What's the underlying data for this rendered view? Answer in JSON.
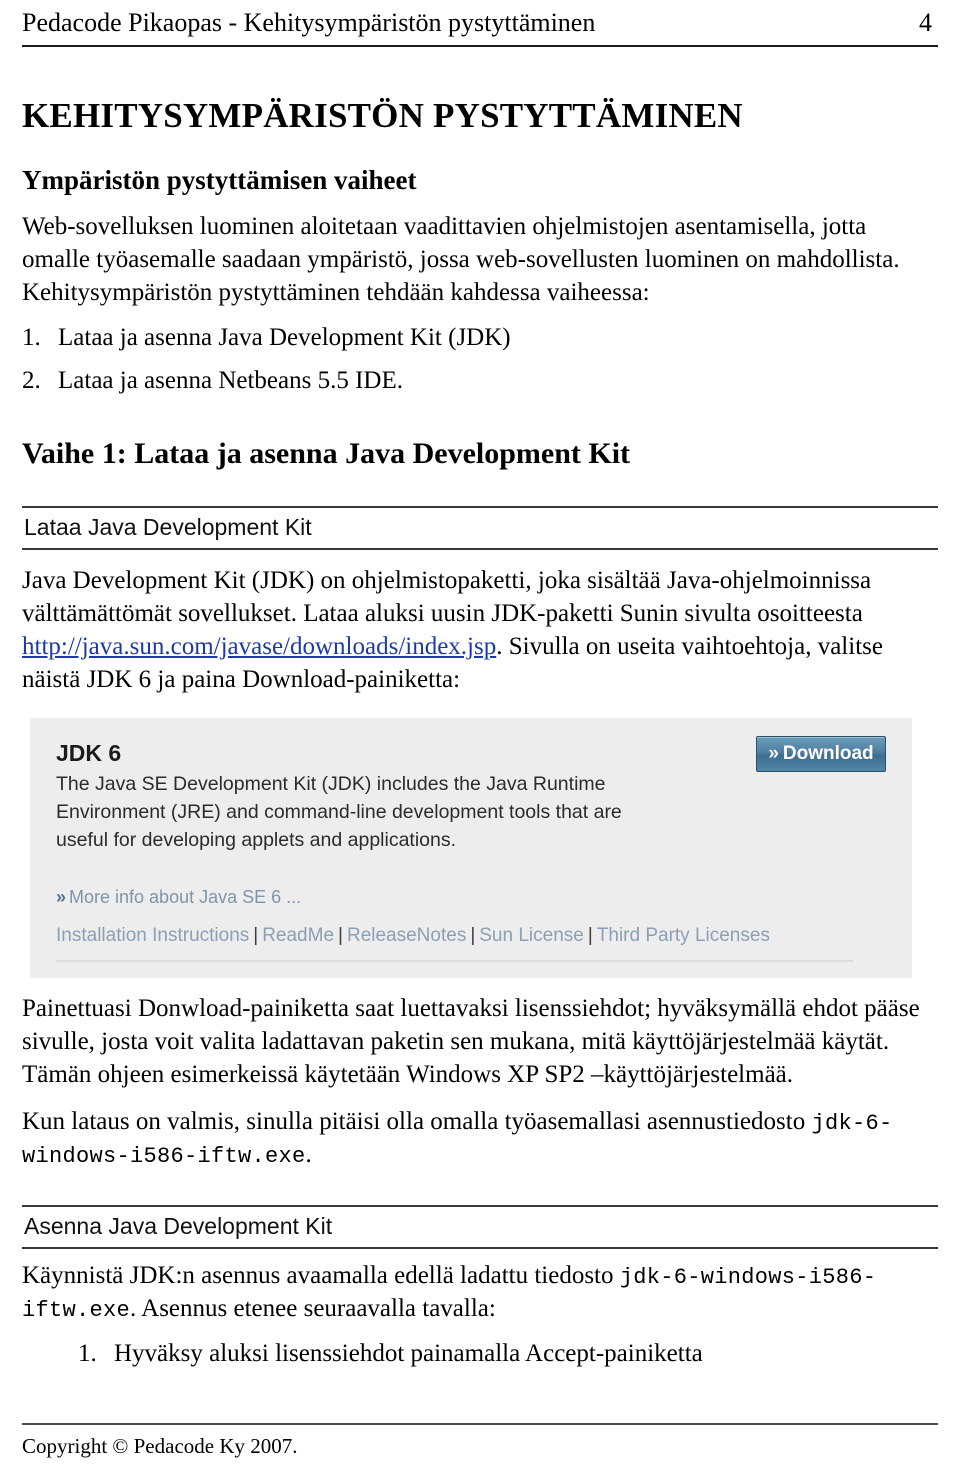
{
  "header": {
    "title": "Pedacode Pikaopas - Kehitysympäristön pystyttäminen",
    "page_number": "4"
  },
  "chapter": {
    "title": "KEHITYSYMPÄRISTÖN PYSTYTTÄMINEN"
  },
  "section_phases": {
    "title": "Ympäristön pystyttämisen vaiheet",
    "intro": "Web-sovelluksen luominen aloitetaan vaadittavien ohjelmistojen asentamisella, jotta omalle työasemalle saadaan ympäristö, jossa web-sovellusten luominen on mahdollista. Kehitysympäristön pystyttäminen tehdään kahdessa vaiheessa:",
    "steps": [
      {
        "num": "1.",
        "text": "Lataa ja asenna Java Development Kit (JDK)"
      },
      {
        "num": "2.",
        "text": "Lataa ja asenna Netbeans 5.5 IDE."
      }
    ]
  },
  "phase1": {
    "title": "Vaihe 1: Lataa ja asenna Java Development Kit"
  },
  "download_jdk": {
    "heading": "Lataa Java Development Kit",
    "paragraph_before_url": "Java Development Kit (JDK) on ohjelmistopaketti, joka sisältää Java-ohjelmoinnissa välttämättömät sovellukset. Lataa aluksi uusin JDK-paketti Sunin sivulta osoitteesta ",
    "url": "http://java.sun.com/javase/downloads/index.jsp",
    "paragraph_after_url": ". Sivulla on useita vaihtoehtoja, valitse näistä JDK 6 ja paina Download-painiketta:"
  },
  "jdk_screenshot": {
    "title": "JDK 6",
    "description": "The Java SE Development Kit (JDK) includes the Java Runtime Environment (JRE) and command-line development tools that are useful for developing applets and applications.",
    "download_button": "Download",
    "download_chevron": "»",
    "more_info": "More info about Java SE 6 ...",
    "more_info_chevron": "»",
    "links": [
      "Installation Instructions",
      "ReadMe",
      "ReleaseNotes",
      "Sun License",
      "Third Party Licenses"
    ],
    "link_separator": "|",
    "background_color": "#ededed",
    "link_color": "#8aa0b6",
    "button_color": "#4d7e9f"
  },
  "after_image": {
    "paragraph1": "Painettuasi Donwload-painiketta saat luettavaksi lisenssiehdot; hyväksymällä ehdot pääse sivulle, josta voit valita ladattavan paketin sen mukana, mitä käyttöjärjestelmää käytät. Tämän ohjeen esimerkeissä käytetään Windows XP SP2 –käyttöjärjestelmää.",
    "paragraph2_before_file": "Kun lataus on valmis, sinulla pitäisi olla omalla työasemallasi asennustiedosto ",
    "filename": "jdk-6-windows-i586-iftw.exe",
    "paragraph2_after_file": "."
  },
  "install_jdk": {
    "heading": "Asenna Java Development Kit",
    "paragraph_before_file": "Käynnistä JDK:n asennus avaamalla edellä ladattu tiedosto ",
    "filename": "jdk-6-windows-i586-iftw.exe",
    "paragraph_after_file": ". Asennus etenee seuraavalla tavalla:",
    "steps": [
      {
        "num": "1.",
        "text": "Hyväksy aluksi lisenssiehdot painamalla Accept-painiketta"
      }
    ]
  },
  "footer": {
    "copyright": "Copyright © Pedacode Ky 2007."
  }
}
